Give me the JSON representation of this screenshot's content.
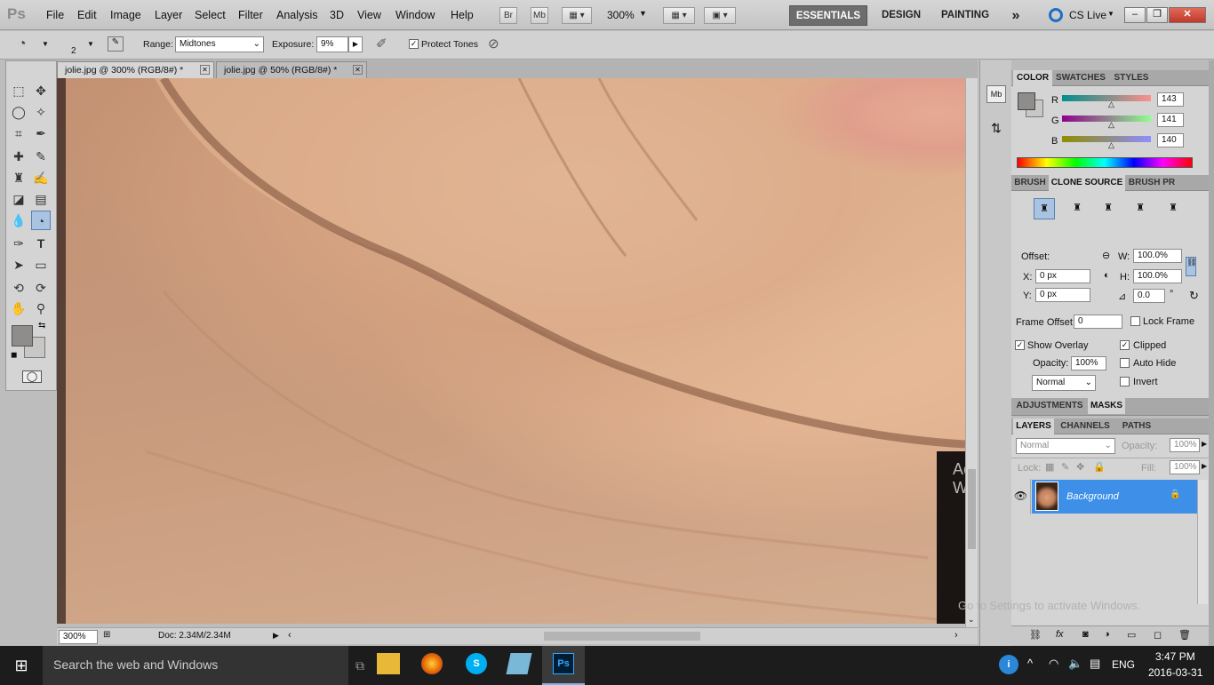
{
  "app": {
    "logo": "Ps"
  },
  "menu": [
    "File",
    "Edit",
    "Image",
    "Layer",
    "Select",
    "Filter",
    "Analysis",
    "3D",
    "View",
    "Window",
    "Help"
  ],
  "menubar": {
    "bridge": "Br",
    "minibridge": "Mb",
    "zoom": "300%",
    "workspaces": [
      "ESSENTIALS",
      "DESIGN",
      "PAINTING"
    ],
    "more": "»",
    "cslive": "CS Live"
  },
  "options": {
    "brush_size": "2",
    "range_label": "Range:",
    "range_value": "Midtones",
    "exposure_label": "Exposure:",
    "exposure_value": "9%",
    "protect_tones": "Protect Tones"
  },
  "tabs": [
    {
      "label": "jolie.jpg @ 300% (RGB/8#) *",
      "active": true
    },
    {
      "label": "jolie.jpg @ 50% (RGB/8#) *",
      "active": false
    }
  ],
  "status": {
    "zoom": "300%",
    "doc": "Doc: 2.34M/2.34M"
  },
  "color_panel": {
    "tabs": [
      "COLOR",
      "SWATCHES",
      "STYLES"
    ],
    "r_label": "R",
    "g_label": "G",
    "b_label": "B",
    "r": 143,
    "g": 141,
    "b": 140
  },
  "clone_panel": {
    "tabs": [
      "BRUSH",
      "CLONE SOURCE",
      "BRUSH PR"
    ],
    "offset": "Offset:",
    "w_label": "W:",
    "w": "100.0%",
    "h_label": "H:",
    "h": "100.0%",
    "x_label": "X:",
    "x": "0 px",
    "y_label": "Y:",
    "y": "0 px",
    "angle": "0.0",
    "deg": "°",
    "frame_offset_label": "Frame Offset:",
    "frame_offset": "0",
    "lock_frame": "Lock Frame",
    "show_overlay": "Show Overlay",
    "clipped": "Clipped",
    "opacity_label": "Opacity:",
    "opacity": "100%",
    "auto_hide": "Auto Hide",
    "mode": "Normal",
    "invert": "Invert"
  },
  "adjust_panel": {
    "tabs": [
      "ADJUSTMENTS",
      "MASKS"
    ]
  },
  "layers_panel": {
    "tabs": [
      "LAYERS",
      "CHANNELS",
      "PATHS"
    ],
    "blend": "Normal",
    "opacity_label": "Opacity:",
    "opacity": "100%",
    "lock_label": "Lock:",
    "fill_label": "Fill:",
    "fill": "100%",
    "layer_name": "Background"
  },
  "watermark": {
    "line1": "Activate Windows",
    "line2": "Go to Settings to activate Windows."
  },
  "taskbar": {
    "search": "Search the web and Windows",
    "lang": "ENG",
    "time": "3:47 PM",
    "date": "2016-03-31"
  }
}
